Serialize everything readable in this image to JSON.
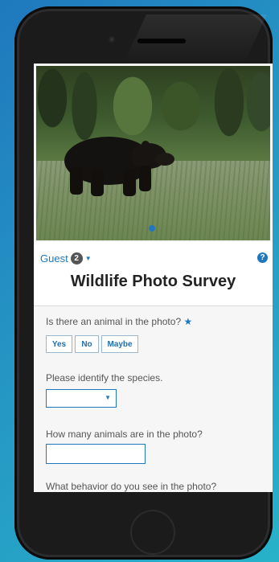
{
  "header": {
    "guest_label": "Guest",
    "guest_count": "2",
    "help": "?",
    "title": "Wildlife Photo Survey"
  },
  "questions": {
    "q1": {
      "label": "Is there an animal in the photo?",
      "required_mark": "★",
      "options": [
        "Yes",
        "No",
        "Maybe"
      ]
    },
    "q2": {
      "label": "Please identify the species.",
      "selected": ""
    },
    "q3": {
      "label": "How many animals are in the photo?",
      "value": ""
    },
    "q4": {
      "label": "What behavior do you see in the photo?"
    }
  },
  "icons": {
    "guest_caret": "caret-down-icon",
    "help": "question-circle-icon",
    "select_caret": "caret-down-icon"
  },
  "colors": {
    "accent": "#1f78bd",
    "background": "#f6f6f6"
  }
}
